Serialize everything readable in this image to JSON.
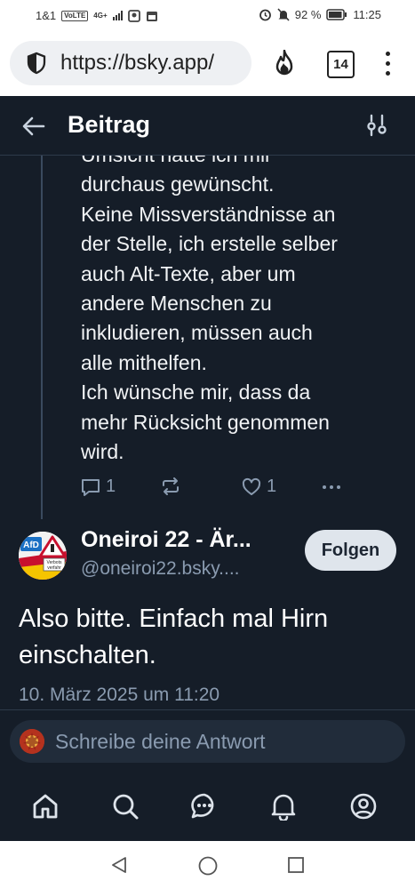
{
  "status_bar": {
    "carrier": "1&1",
    "volte": "VoLTE",
    "network": "4G+",
    "battery": "92 %",
    "time": "11:25"
  },
  "browser": {
    "url": "https://bsky.app/",
    "tab_count": "14"
  },
  "header": {
    "title": "Beitrag"
  },
  "previous_post": {
    "lines": [
      "Umsicht hätte ich mir",
      "durchaus gewünscht.",
      "Keine Missverständnisse an",
      "der Stelle, ich erstelle selber",
      "auch Alt-Texte, aber um",
      "andere Menschen zu",
      "inkludieren, müssen auch",
      "alle mithelfen.",
      "Ich wünsche mir, dass da",
      "mehr Rücksicht genommen",
      "wird."
    ],
    "reply_count": "1",
    "like_count": "1"
  },
  "main_post": {
    "author_name": "Oneiroi 22 - Är...",
    "author_handle": "@oneiroi22.bsky....",
    "follow_label": "Folgen",
    "avatar_text": "AfD",
    "avatar_sign_text": "Verbots verfahr",
    "text_lines": [
      "Also bitte. Einfach mal Hirn",
      "einschalten."
    ],
    "date": "10. März 2025 um 11:20"
  },
  "reply": {
    "placeholder": "Schreibe deine Antwort"
  },
  "bottom_nav": [
    "home",
    "search",
    "chat",
    "notifications",
    "profile"
  ],
  "colors": {
    "app_bg": "#151d28",
    "muted_text": "#8a9bb0",
    "follow_bg": "#dfe5ec"
  }
}
